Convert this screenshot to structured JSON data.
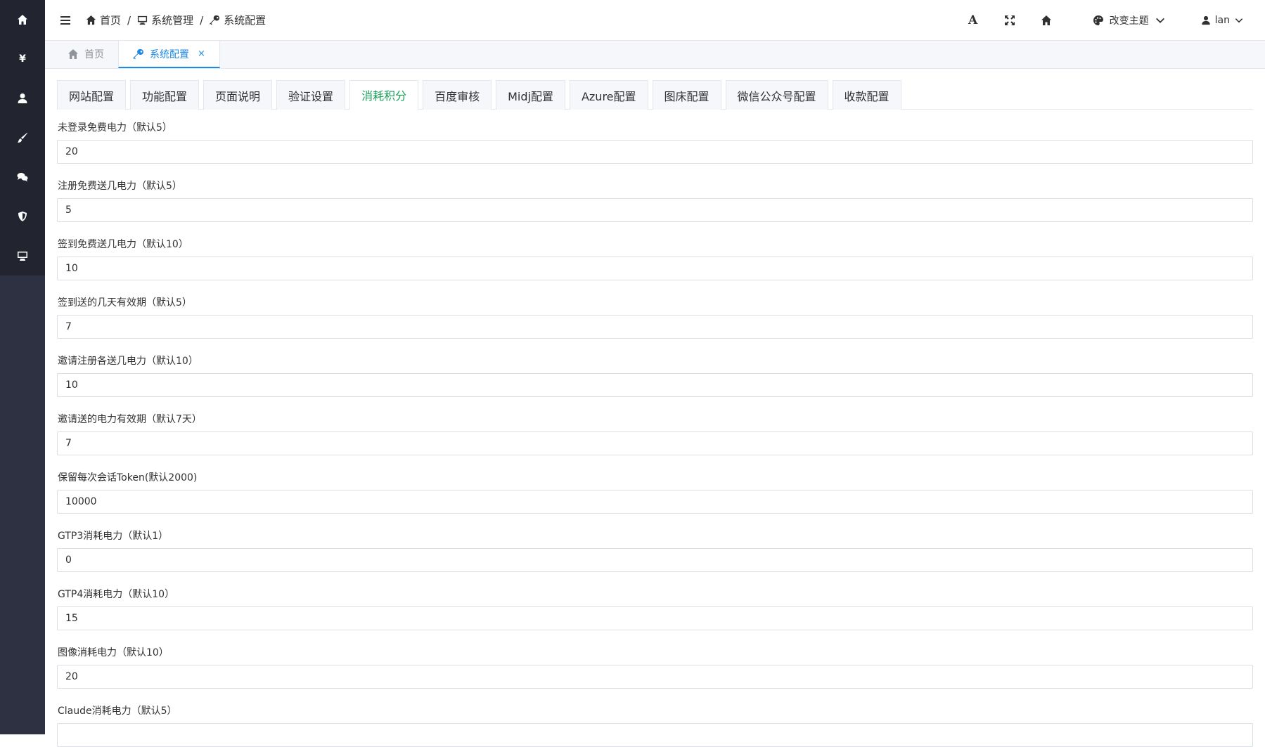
{
  "sidebar": {
    "items": [
      {
        "icon": "home-icon"
      },
      {
        "icon": "yen-icon",
        "glyph": "¥"
      },
      {
        "icon": "user-icon"
      },
      {
        "icon": "brush-icon"
      },
      {
        "icon": "chat-icon"
      },
      {
        "icon": "shield-icon"
      },
      {
        "icon": "monitor-icon"
      }
    ]
  },
  "header": {
    "breadcrumb": [
      "首页",
      "系统管理",
      "系统配置"
    ],
    "theme_label": "改变主题",
    "user_name": "lan"
  },
  "tags": [
    {
      "label": "首页",
      "active": false
    },
    {
      "label": "系统配置",
      "active": true,
      "close": "×"
    }
  ],
  "config_tabs": [
    {
      "label": "网站配置"
    },
    {
      "label": "功能配置"
    },
    {
      "label": "页面说明"
    },
    {
      "label": "验证设置"
    },
    {
      "label": "消耗积分",
      "active": true
    },
    {
      "label": "百度审核"
    },
    {
      "label": "Midj配置"
    },
    {
      "label": "Azure配置"
    },
    {
      "label": "图床配置"
    },
    {
      "label": "微信公众号配置"
    },
    {
      "label": "收款配置"
    }
  ],
  "fields": [
    {
      "label": "未登录免费电力（默认5）",
      "value": "20"
    },
    {
      "label": "注册免费送几电力（默认5）",
      "value": "5"
    },
    {
      "label": "签到免费送几电力（默认10）",
      "value": "10"
    },
    {
      "label": "签到送的几天有效期（默认5）",
      "value": "7"
    },
    {
      "label": "邀请注册各送几电力（默认10）",
      "value": "10"
    },
    {
      "label": "邀请送的电力有效期（默认7天）",
      "value": "7"
    },
    {
      "label": "保留每次会话Token(默认2000)",
      "value": "10000"
    },
    {
      "label": "GTP3消耗电力（默认1）",
      "value": "0"
    },
    {
      "label": "GTP4消耗电力（默认10）",
      "value": "15"
    },
    {
      "label": "图像消耗电力（默认10）",
      "value": "20"
    },
    {
      "label": "Claude消耗电力（默认5）",
      "value": ""
    }
  ],
  "colors": {
    "sidebar_bg": "#2d3142",
    "active_tab_accent": "#1e88e5",
    "active_config_tab": "#18a058"
  }
}
